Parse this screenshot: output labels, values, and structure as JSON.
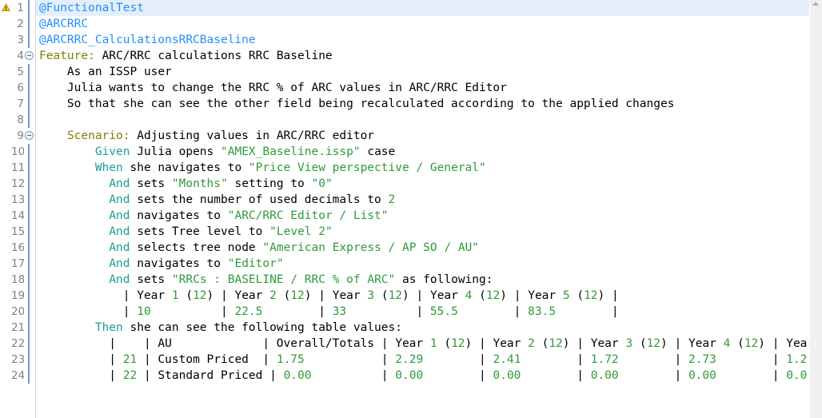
{
  "editor": {
    "file_type": "gherkin-feature",
    "current_line": 1,
    "icons": {
      "warning": "warning-icon",
      "fold_collapse": "fold-collapse-icon",
      "scroll_up": "scroll-up-arrow-icon"
    },
    "colors": {
      "tag": "#1e90ff",
      "keyword": "#808000",
      "step_keyword": "#1b9b9b",
      "string": "#2e9b3a",
      "number": "#2e9b3a",
      "plain": "#000000",
      "line_number": "#808080",
      "current_line_bg": "#e4effb",
      "background": "#ffffff"
    },
    "line_numbers": [
      "1",
      "2",
      "3",
      "4",
      "5",
      "6",
      "7",
      "8",
      "9",
      "10",
      "11",
      "12",
      "13",
      "14",
      "15",
      "16",
      "17",
      "18",
      "19",
      "20",
      "21",
      "22",
      "23",
      "24"
    ],
    "fold_markers": [
      4,
      9
    ],
    "lines": [
      {
        "n": 1,
        "fold": false,
        "current": true,
        "tokens": [
          {
            "t": "tag",
            "v": "@FunctionalTest"
          }
        ]
      },
      {
        "n": 2,
        "fold": false,
        "current": false,
        "tokens": [
          {
            "t": "tag",
            "v": "@ARCRRC"
          }
        ]
      },
      {
        "n": 3,
        "fold": false,
        "current": false,
        "tokens": [
          {
            "t": "tag",
            "v": "@ARCRRC_CalculationsRRCBaseline"
          }
        ]
      },
      {
        "n": 4,
        "fold": true,
        "current": false,
        "tokens": [
          {
            "t": "keyword",
            "v": "Feature:"
          },
          {
            "t": "plain",
            "v": " ARC/RRC calculations RRC Baseline"
          }
        ]
      },
      {
        "n": 5,
        "fold": false,
        "current": false,
        "tokens": [
          {
            "t": "plain",
            "v": "    As an ISSP user"
          }
        ]
      },
      {
        "n": 6,
        "fold": false,
        "current": false,
        "tokens": [
          {
            "t": "plain",
            "v": "    Julia wants to change the RRC % of ARC values in ARC/RRC Editor"
          }
        ]
      },
      {
        "n": 7,
        "fold": false,
        "current": false,
        "tokens": [
          {
            "t": "plain",
            "v": "    So that she can see the other field being recalculated according to the applied changes"
          }
        ]
      },
      {
        "n": 8,
        "fold": false,
        "current": false,
        "tokens": [
          {
            "t": "plain",
            "v": ""
          }
        ]
      },
      {
        "n": 9,
        "fold": true,
        "current": false,
        "tokens": [
          {
            "t": "plain",
            "v": "    "
          },
          {
            "t": "keyword",
            "v": "Scenario:"
          },
          {
            "t": "plain",
            "v": " Adjusting values in ARC/RRC editor"
          }
        ]
      },
      {
        "n": 10,
        "fold": false,
        "current": false,
        "tokens": [
          {
            "t": "plain",
            "v": "        "
          },
          {
            "t": "step",
            "v": "Given"
          },
          {
            "t": "plain",
            "v": " Julia opens "
          },
          {
            "t": "string",
            "v": "\"AMEX_Baseline.issp\""
          },
          {
            "t": "plain",
            "v": " case"
          }
        ]
      },
      {
        "n": 11,
        "fold": false,
        "current": false,
        "tokens": [
          {
            "t": "plain",
            "v": "        "
          },
          {
            "t": "step",
            "v": "When"
          },
          {
            "t": "plain",
            "v": " she navigates to "
          },
          {
            "t": "string",
            "v": "\"Price View perspective / General\""
          }
        ]
      },
      {
        "n": 12,
        "fold": false,
        "current": false,
        "tokens": [
          {
            "t": "plain",
            "v": "          "
          },
          {
            "t": "step",
            "v": "And"
          },
          {
            "t": "plain",
            "v": " sets "
          },
          {
            "t": "string",
            "v": "\"Months\""
          },
          {
            "t": "plain",
            "v": " setting to "
          },
          {
            "t": "string",
            "v": "\"0\""
          }
        ]
      },
      {
        "n": 13,
        "fold": false,
        "current": false,
        "tokens": [
          {
            "t": "plain",
            "v": "          "
          },
          {
            "t": "step",
            "v": "And"
          },
          {
            "t": "plain",
            "v": " sets the number of used decimals to "
          },
          {
            "t": "num",
            "v": "2"
          }
        ]
      },
      {
        "n": 14,
        "fold": false,
        "current": false,
        "tokens": [
          {
            "t": "plain",
            "v": "          "
          },
          {
            "t": "step",
            "v": "And"
          },
          {
            "t": "plain",
            "v": " navigates to "
          },
          {
            "t": "string",
            "v": "\"ARC/RRC Editor / List\""
          }
        ]
      },
      {
        "n": 15,
        "fold": false,
        "current": false,
        "tokens": [
          {
            "t": "plain",
            "v": "          "
          },
          {
            "t": "step",
            "v": "And"
          },
          {
            "t": "plain",
            "v": " sets Tree level to "
          },
          {
            "t": "string",
            "v": "\"Level 2\""
          }
        ]
      },
      {
        "n": 16,
        "fold": false,
        "current": false,
        "tokens": [
          {
            "t": "plain",
            "v": "          "
          },
          {
            "t": "step",
            "v": "And"
          },
          {
            "t": "plain",
            "v": " selects tree node "
          },
          {
            "t": "string",
            "v": "\"American Express / AP SO / AU\""
          }
        ]
      },
      {
        "n": 17,
        "fold": false,
        "current": false,
        "tokens": [
          {
            "t": "plain",
            "v": "          "
          },
          {
            "t": "step",
            "v": "And"
          },
          {
            "t": "plain",
            "v": " navigates to "
          },
          {
            "t": "string",
            "v": "\"Editor\""
          }
        ]
      },
      {
        "n": 18,
        "fold": false,
        "current": false,
        "tokens": [
          {
            "t": "plain",
            "v": "          "
          },
          {
            "t": "step",
            "v": "And"
          },
          {
            "t": "plain",
            "v": " sets "
          },
          {
            "t": "string",
            "v": "\"RRCs : BASELINE / RRC % of ARC\""
          },
          {
            "t": "plain",
            "v": " as following:"
          }
        ]
      },
      {
        "n": 19,
        "fold": false,
        "current": false,
        "tokens": [
          {
            "t": "plain",
            "v": "            | Year "
          },
          {
            "t": "num",
            "v": "1"
          },
          {
            "t": "plain",
            "v": " ("
          },
          {
            "t": "num",
            "v": "12"
          },
          {
            "t": "plain",
            "v": ") | Year "
          },
          {
            "t": "num",
            "v": "2"
          },
          {
            "t": "plain",
            "v": " ("
          },
          {
            "t": "num",
            "v": "12"
          },
          {
            "t": "plain",
            "v": ") | Year "
          },
          {
            "t": "num",
            "v": "3"
          },
          {
            "t": "plain",
            "v": " ("
          },
          {
            "t": "num",
            "v": "12"
          },
          {
            "t": "plain",
            "v": ") | Year "
          },
          {
            "t": "num",
            "v": "4"
          },
          {
            "t": "plain",
            "v": " ("
          },
          {
            "t": "num",
            "v": "12"
          },
          {
            "t": "plain",
            "v": ") | Year "
          },
          {
            "t": "num",
            "v": "5"
          },
          {
            "t": "plain",
            "v": " ("
          },
          {
            "t": "num",
            "v": "12"
          },
          {
            "t": "plain",
            "v": ") |"
          }
        ]
      },
      {
        "n": 20,
        "fold": false,
        "current": false,
        "tokens": [
          {
            "t": "plain",
            "v": "            | "
          },
          {
            "t": "num",
            "v": "10"
          },
          {
            "t": "plain",
            "v": "          | "
          },
          {
            "t": "num",
            "v": "22.5"
          },
          {
            "t": "plain",
            "v": "        | "
          },
          {
            "t": "num",
            "v": "33"
          },
          {
            "t": "plain",
            "v": "          | "
          },
          {
            "t": "num",
            "v": "55.5"
          },
          {
            "t": "plain",
            "v": "        | "
          },
          {
            "t": "num",
            "v": "83.5"
          },
          {
            "t": "plain",
            "v": "        |"
          }
        ]
      },
      {
        "n": 21,
        "fold": false,
        "current": false,
        "tokens": [
          {
            "t": "plain",
            "v": "        "
          },
          {
            "t": "step",
            "v": "Then"
          },
          {
            "t": "plain",
            "v": " she can see the following table values:"
          }
        ]
      },
      {
        "n": 22,
        "fold": false,
        "current": false,
        "tokens": [
          {
            "t": "plain",
            "v": "          |    | AU             | Overall/Totals | Year "
          },
          {
            "t": "num",
            "v": "1"
          },
          {
            "t": "plain",
            "v": " ("
          },
          {
            "t": "num",
            "v": "12"
          },
          {
            "t": "plain",
            "v": ") | Year "
          },
          {
            "t": "num",
            "v": "2"
          },
          {
            "t": "plain",
            "v": " ("
          },
          {
            "t": "num",
            "v": "12"
          },
          {
            "t": "plain",
            "v": ") | Year "
          },
          {
            "t": "num",
            "v": "3"
          },
          {
            "t": "plain",
            "v": " ("
          },
          {
            "t": "num",
            "v": "12"
          },
          {
            "t": "plain",
            "v": ") | Year "
          },
          {
            "t": "num",
            "v": "4"
          },
          {
            "t": "plain",
            "v": " ("
          },
          {
            "t": "num",
            "v": "12"
          },
          {
            "t": "plain",
            "v": ") | Year"
          }
        ]
      },
      {
        "n": 23,
        "fold": false,
        "current": false,
        "tokens": [
          {
            "t": "plain",
            "v": "          | "
          },
          {
            "t": "num",
            "v": "21"
          },
          {
            "t": "plain",
            "v": " | Custom Priced  | "
          },
          {
            "t": "num",
            "v": "1.75"
          },
          {
            "t": "plain",
            "v": "           | "
          },
          {
            "t": "num",
            "v": "2.29"
          },
          {
            "t": "plain",
            "v": "        | "
          },
          {
            "t": "num",
            "v": "2.41"
          },
          {
            "t": "plain",
            "v": "        | "
          },
          {
            "t": "num",
            "v": "1.72"
          },
          {
            "t": "plain",
            "v": "        | "
          },
          {
            "t": "num",
            "v": "2.73"
          },
          {
            "t": "plain",
            "v": "        | "
          },
          {
            "t": "num",
            "v": "1.2"
          }
        ]
      },
      {
        "n": 24,
        "fold": false,
        "current": false,
        "tokens": [
          {
            "t": "plain",
            "v": "          | "
          },
          {
            "t": "num",
            "v": "22"
          },
          {
            "t": "plain",
            "v": " | Standard Priced | "
          },
          {
            "t": "num",
            "v": "0.00"
          },
          {
            "t": "plain",
            "v": "          | "
          },
          {
            "t": "num",
            "v": "0.00"
          },
          {
            "t": "plain",
            "v": "        | "
          },
          {
            "t": "num",
            "v": "0.00"
          },
          {
            "t": "plain",
            "v": "        | "
          },
          {
            "t": "num",
            "v": "0.00"
          },
          {
            "t": "plain",
            "v": "        | "
          },
          {
            "t": "num",
            "v": "0.00"
          },
          {
            "t": "plain",
            "v": "        | "
          },
          {
            "t": "num",
            "v": "0.0"
          }
        ]
      }
    ]
  }
}
